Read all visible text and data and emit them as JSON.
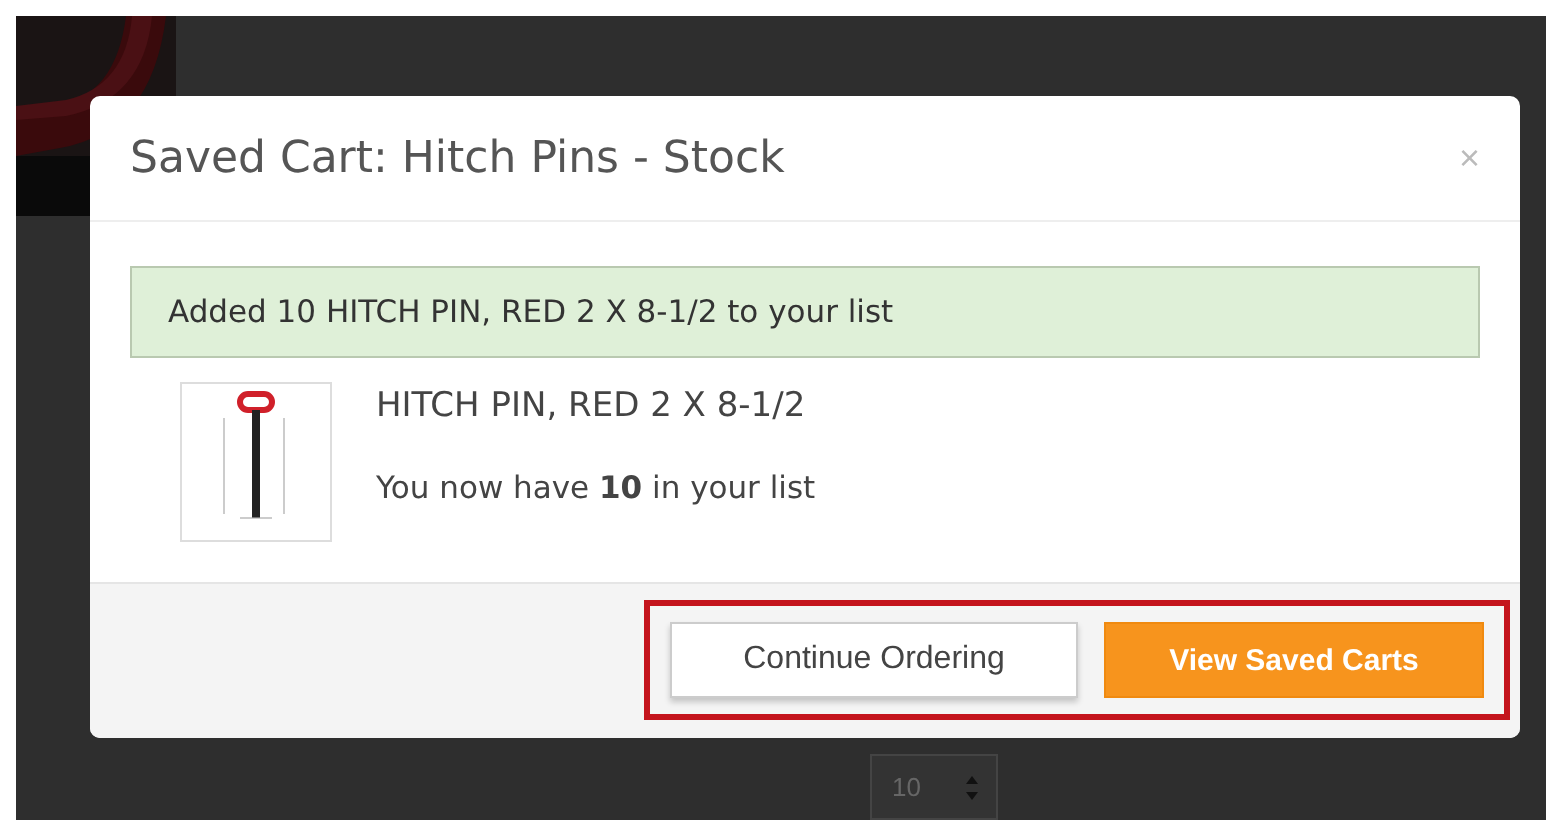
{
  "dialog": {
    "title": "Saved Cart: Hitch Pins - Stock",
    "close": "×",
    "alert": {
      "before": "Added 10 HITCH PIN, RED 2 X 8-1/2 to your list"
    },
    "product": {
      "name": "HITCH PIN, RED 2 X 8-1/2",
      "note": "You now have **10** in your list"
    },
    "buttons": [
      {
        "label": "Continue Ordering",
        "kind": "default"
      },
      {
        "label": "View Saved Carts",
        "kind": "primary"
      }
    ]
  },
  "quantity": {
    "value": "10"
  }
}
